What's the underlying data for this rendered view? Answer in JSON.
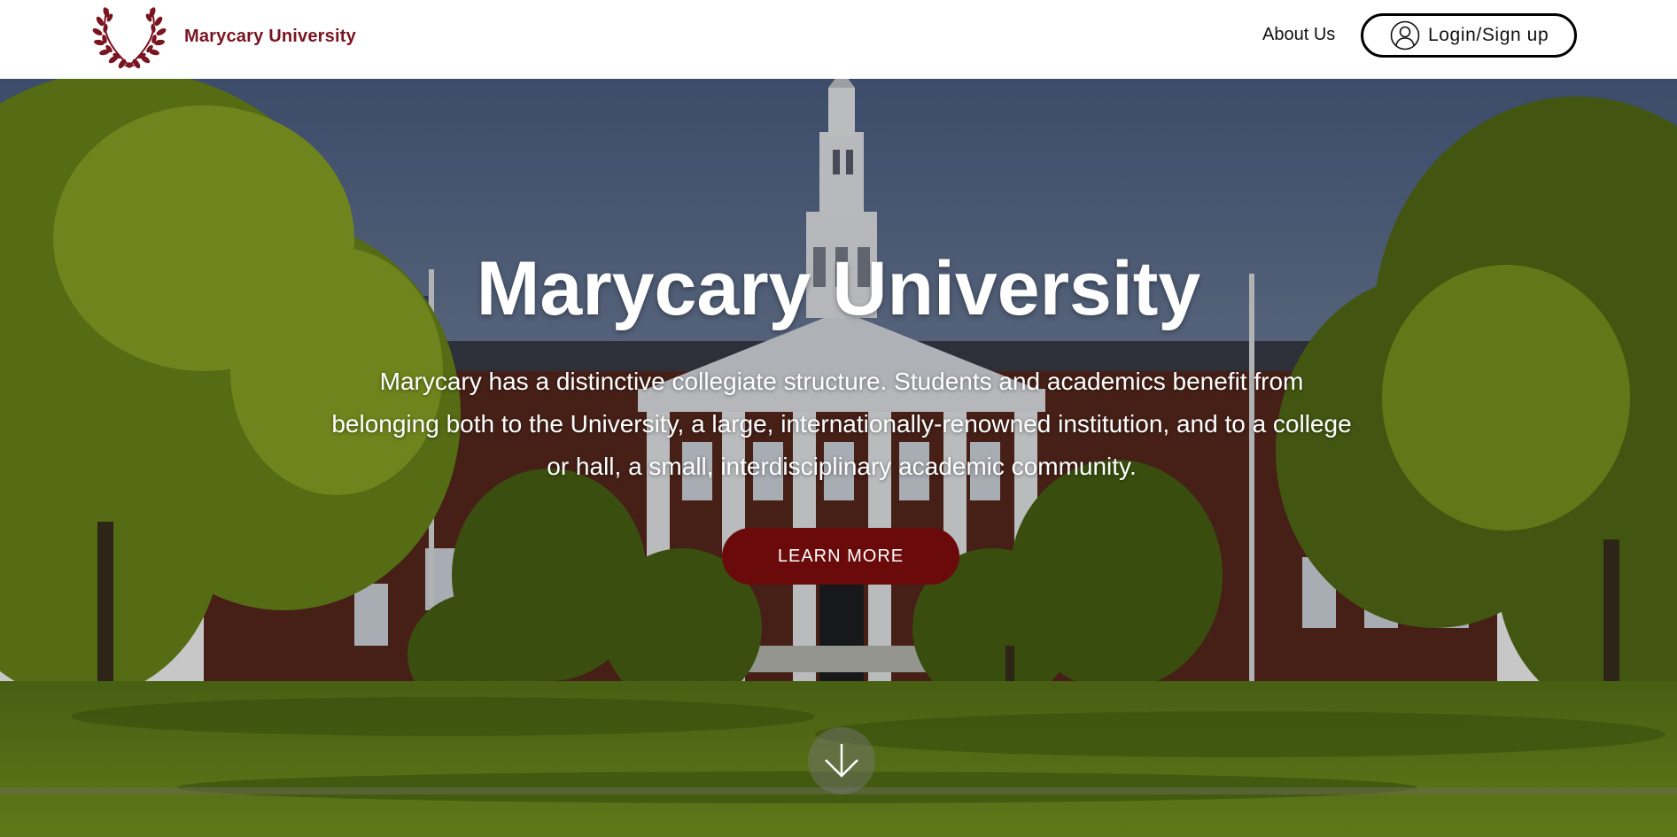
{
  "header": {
    "brand_name": "Marycary University",
    "logo_icon": "laurel-wreath-icon",
    "about_label": "About Us",
    "login_label": "Login/Sign up",
    "login_icon": "user-circle-icon"
  },
  "hero": {
    "title": "Marycary University",
    "description": "Marycary has a distinctive collegiate structure. Students and academics benefit from belonging both to the University, a large, internationally-renowned institution, and to a college or hall, a small, interdisciplinary academic community.",
    "cta_label": "LEARN MORE",
    "scroll_icon": "arrow-down-icon"
  },
  "colors": {
    "brand": "#7a1420",
    "cta_background": "#6b0a0a",
    "header_background": "#ffffff",
    "hero_text": "#ffffff"
  }
}
